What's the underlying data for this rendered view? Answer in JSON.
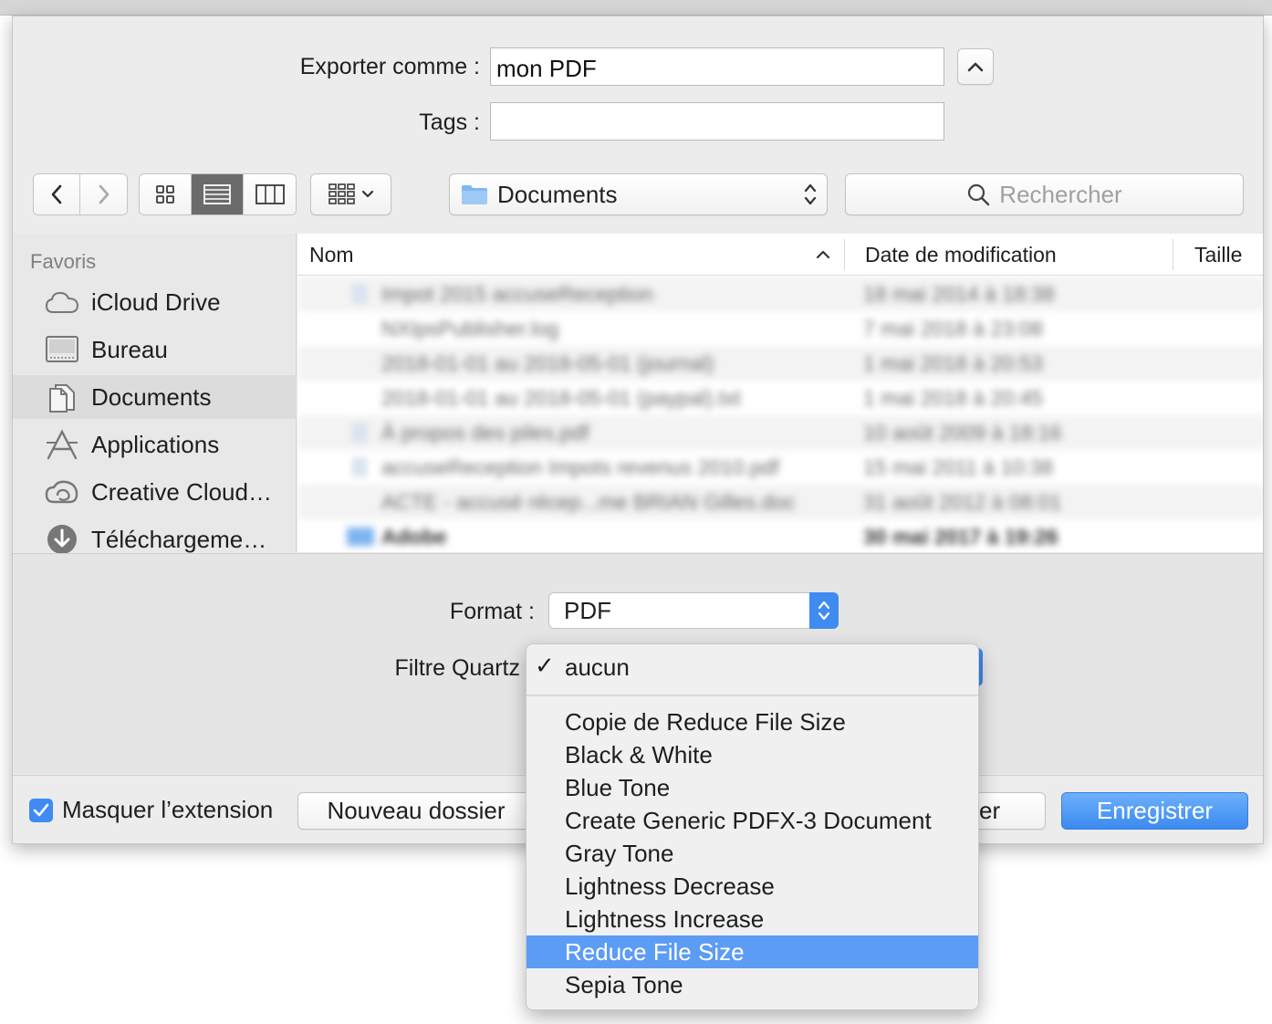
{
  "dialog": {
    "export_label": "Exporter comme :",
    "export_value": "mon PDF",
    "tags_label": "Tags :",
    "tags_value": ""
  },
  "toolbar": {
    "location": "Documents",
    "search_placeholder": "Rechercher"
  },
  "sidebar": {
    "heading": "Favoris",
    "items": [
      {
        "label": "iCloud Drive",
        "icon": "cloud-icon"
      },
      {
        "label": "Bureau",
        "icon": "desktop-icon"
      },
      {
        "label": "Documents",
        "icon": "documents-icon"
      },
      {
        "label": "Applications",
        "icon": "applications-icon"
      },
      {
        "label": "Creative Cloud…",
        "icon": "creative-cloud-icon"
      },
      {
        "label": "Téléchargeme…",
        "icon": "downloads-icon"
      }
    ]
  },
  "filelist": {
    "columns": [
      "Nom",
      "Date de modification",
      "Taille"
    ],
    "rows": [
      {
        "name": "Impot 2015 accuseReception",
        "date": "18 mai 2014 à 18:38"
      },
      {
        "name": "NXIpsPublisher.log",
        "date": "7 mai 2018 à 23:08"
      },
      {
        "name": "2018-01-01 au 2018-05-01 (journal)",
        "date": "1 mai 2018 à 20:53"
      },
      {
        "name": "2018-01-01 au 2018-05-01 (paypal).txt",
        "date": "1 mai 2018 à 20:45"
      },
      {
        "name": "À propos des piles.pdf",
        "date": "10 août 2009 à 18:16"
      },
      {
        "name": "accuseReception Impots revenus 2010.pdf",
        "date": "15 mai 2011 à 10:38"
      },
      {
        "name": "ACTE - accusé récep...me BRIAN Gilles.doc",
        "date": "31 août 2012 à 08:01"
      },
      {
        "name": "Adobe",
        "date": "30 mai 2017 à 19:26",
        "folder": true
      }
    ]
  },
  "options": {
    "format_label": "Format :",
    "format_value": "PDF",
    "quartz_label": "Filtre Quartz"
  },
  "bottom": {
    "hide_extension_label": "Masquer l’extension",
    "new_folder_label": "Nouveau dossier",
    "cancel_partial_label": "er",
    "save_label": "Enregistrer"
  },
  "quartz_menu": {
    "selected": "aucun",
    "check_glyph": "✓",
    "items": [
      "Copie de Reduce File Size",
      "Black & White",
      "Blue Tone",
      "Create Generic PDFX-3 Document",
      "Gray Tone",
      "Lightness Decrease",
      "Lightness Increase",
      "Reduce File Size",
      "Sepia Tone"
    ],
    "highlighted": "Reduce File Size"
  },
  "colors": {
    "accent": "#3f8bf1",
    "highlight": "#5c9cf4"
  }
}
